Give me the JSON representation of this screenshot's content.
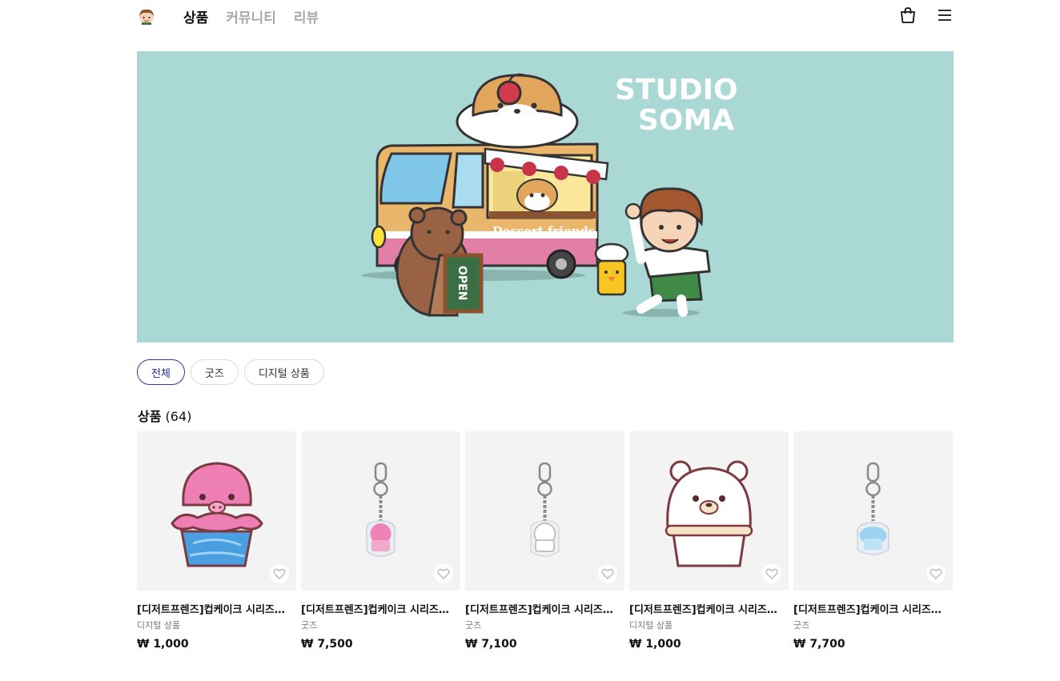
{
  "nav": {
    "items": [
      {
        "label": "상품",
        "active": true
      },
      {
        "label": "커뮤니티",
        "active": false
      },
      {
        "label": "리뷰",
        "active": false
      }
    ]
  },
  "banner": {
    "brand_line1": "STUDIO",
    "brand_line2": "SOMA",
    "truck_text": "Dessert friends",
    "sign_text": "OPEN",
    "background": "#aad8d5"
  },
  "filters": [
    {
      "label": "전체",
      "active": true
    },
    {
      "label": "굿즈",
      "active": false
    },
    {
      "label": "디지털 상품",
      "active": false
    }
  ],
  "section": {
    "title": "상품",
    "count": "(64)"
  },
  "products": [
    {
      "name": "[디저트프렌즈]컵케이크 시리즈...",
      "category": "디지털 상품",
      "price": "₩ 1,000",
      "art": "octopus-cupcake-icon"
    },
    {
      "name": "[디저트프렌즈]컵케이크 시리즈...",
      "category": "굿즈",
      "price": "₩ 7,500",
      "art": "pink-keyring-icon"
    },
    {
      "name": "[디저트프렌즈]컵케이크 시리즈...",
      "category": "굿즈",
      "price": "₩ 7,100",
      "art": "white-keyring-icon"
    },
    {
      "name": "[디저트프렌즈]컵케이크 시리즈...",
      "category": "디지털 상품",
      "price": "₩ 1,000",
      "art": "polar-bear-cupcake-icon"
    },
    {
      "name": "[디저트프렌즈]컵케이크 시리즈...",
      "category": "굿즈",
      "price": "₩ 7,700",
      "art": "blue-keyring-icon"
    }
  ],
  "colors": {
    "accent": "#1f2b8a",
    "thumb_bg": "#f3f3f3"
  }
}
